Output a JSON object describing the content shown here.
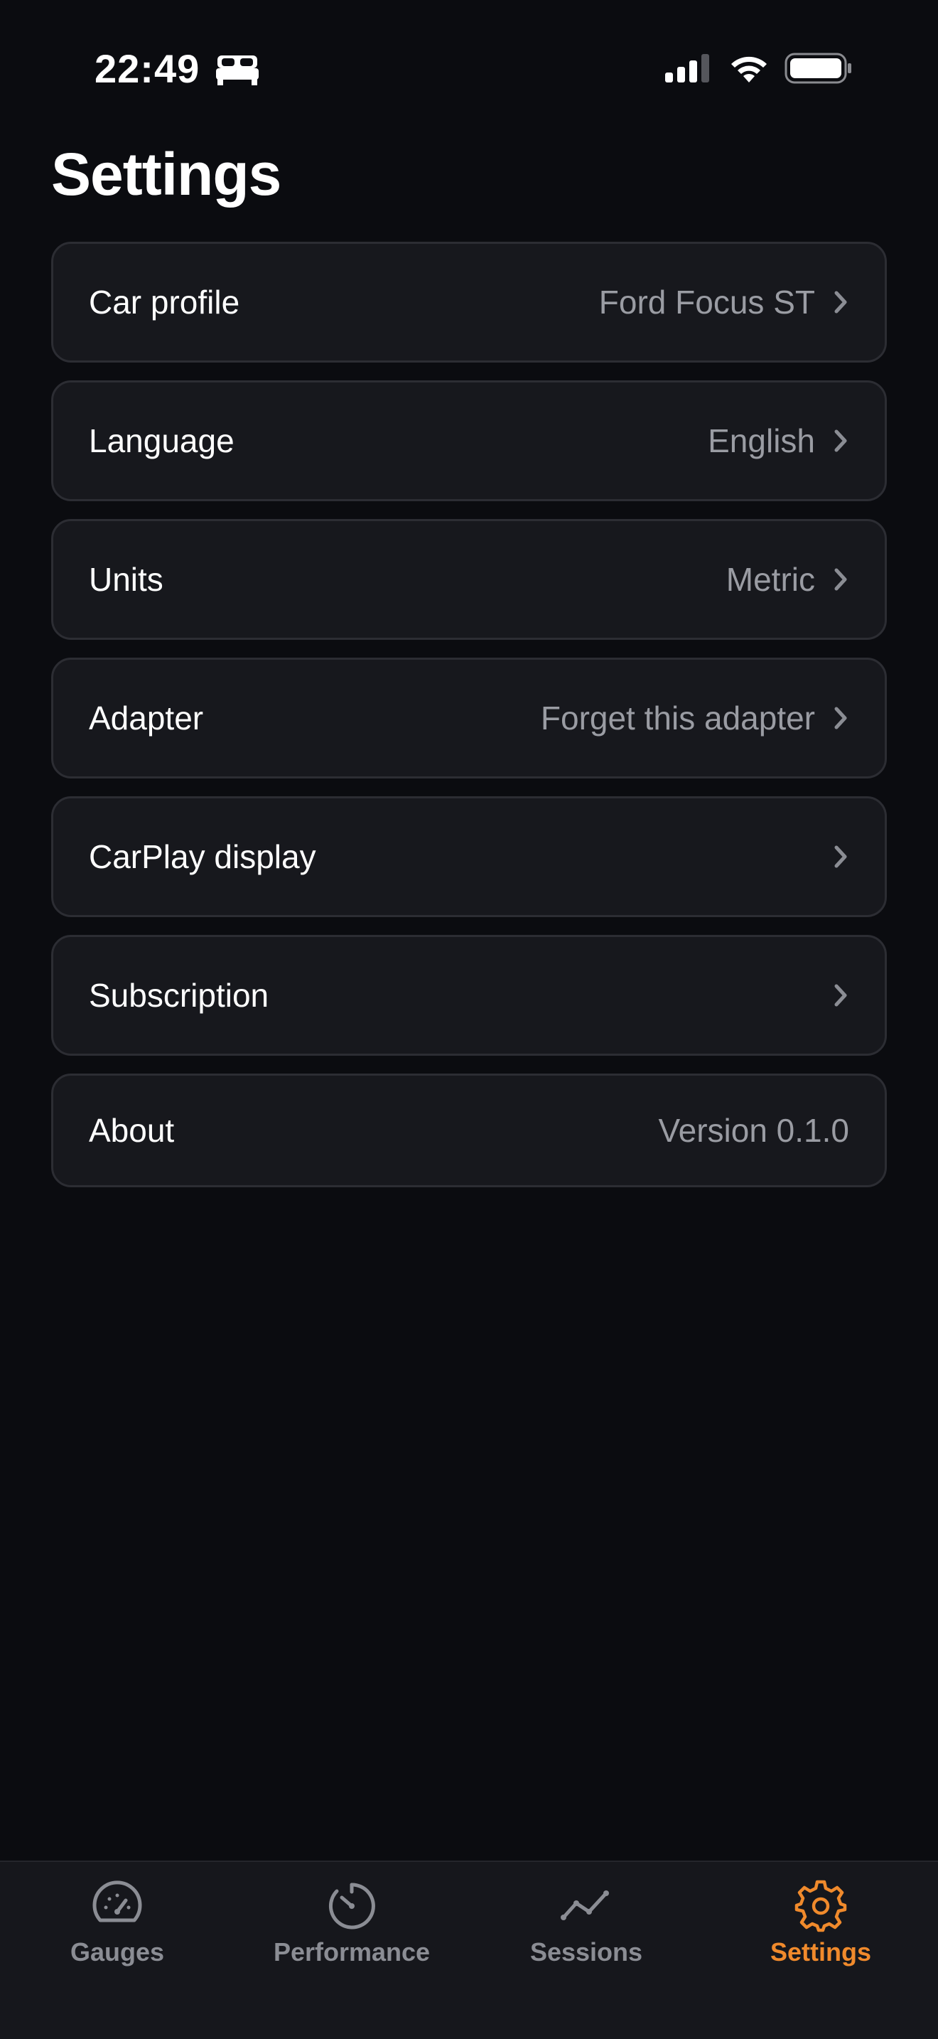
{
  "status_bar": {
    "time": "22:49",
    "focus_icon": "bed-icon",
    "signal_icon": "cellular-signal-icon",
    "wifi_icon": "wifi-icon",
    "battery_icon": "battery-icon"
  },
  "page": {
    "title": "Settings"
  },
  "settings": {
    "items": [
      {
        "label": "Car profile",
        "value": "Ford Focus ST",
        "has_chevron": true
      },
      {
        "label": "Language",
        "value": "English",
        "has_chevron": true
      },
      {
        "label": "Units",
        "value": "Metric",
        "has_chevron": true
      },
      {
        "label": "Adapter",
        "value": "Forget this adapter",
        "has_chevron": true
      },
      {
        "label": "CarPlay display",
        "value": "",
        "has_chevron": true
      },
      {
        "label": "Subscription",
        "value": "",
        "has_chevron": true
      },
      {
        "label": "About",
        "value": "Version 0.1.0",
        "has_chevron": false
      }
    ]
  },
  "tab_bar": {
    "tabs": [
      {
        "label": "Gauges",
        "icon": "speedometer-icon",
        "active": false
      },
      {
        "label": "Performance",
        "icon": "timer-icon",
        "active": false
      },
      {
        "label": "Sessions",
        "icon": "line-chart-icon",
        "active": false
      },
      {
        "label": "Settings",
        "icon": "gear-icon",
        "active": true
      }
    ]
  },
  "colors": {
    "background": "#0b0c10",
    "row_background": "#17181d",
    "row_border": "#2c2d33",
    "secondary_text": "#9a9ca3",
    "accent": "#f08a2c",
    "inactive_tab": "#8b8d94"
  }
}
